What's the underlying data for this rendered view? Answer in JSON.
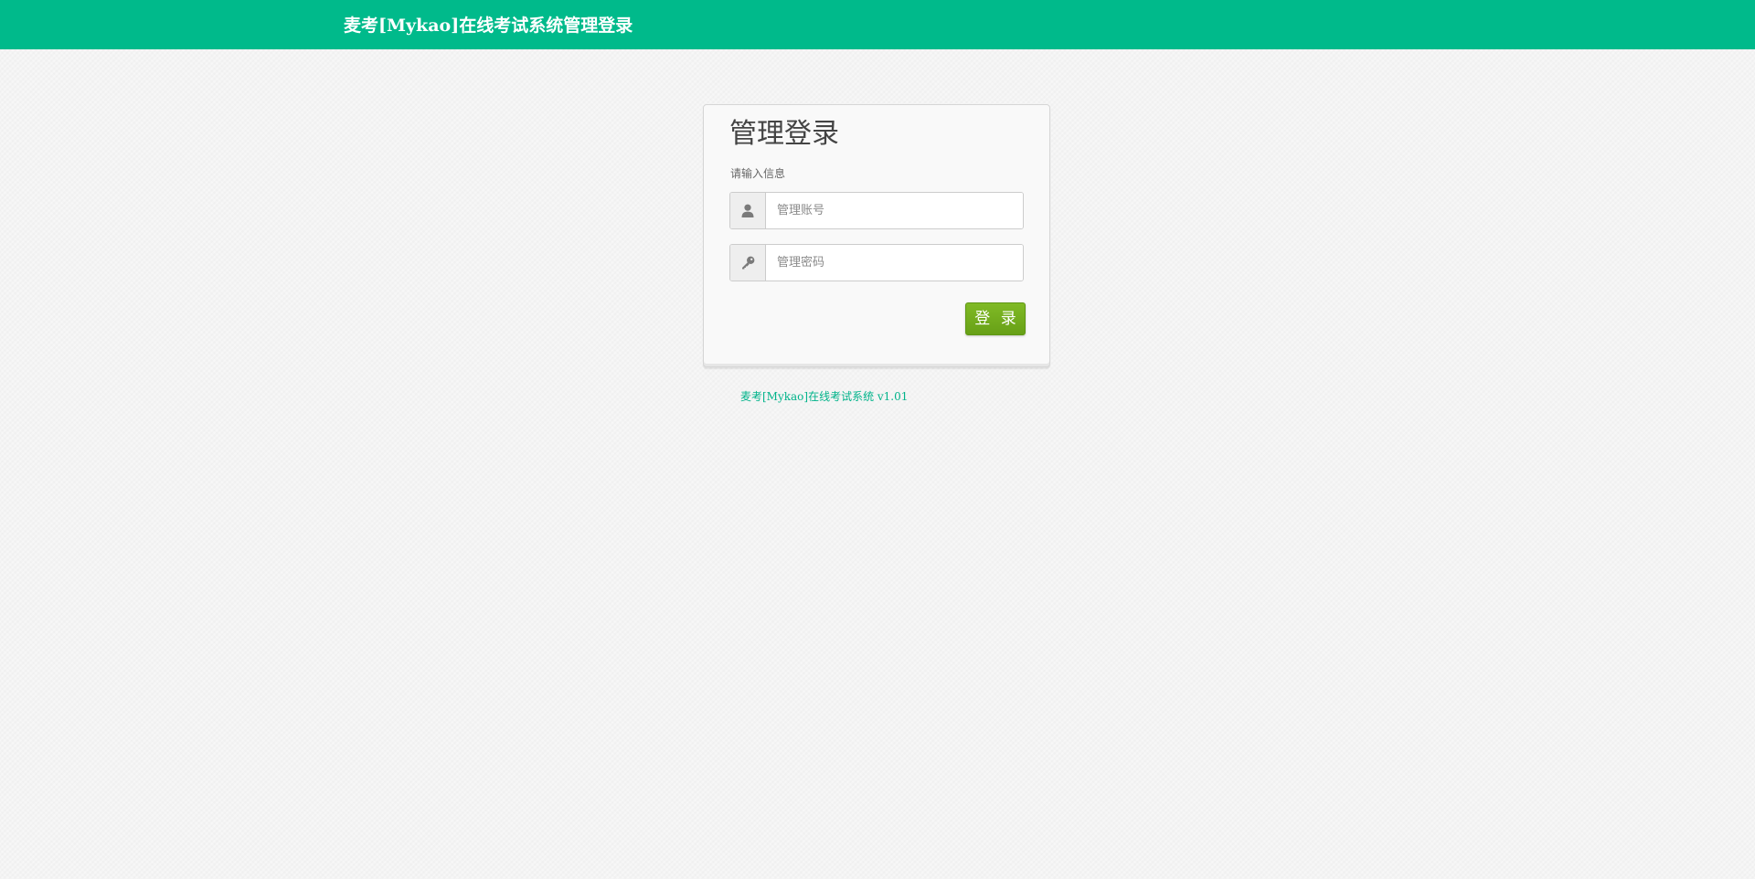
{
  "header": {
    "brand": "麦考[Mykao]在线考试系统管理登录"
  },
  "login": {
    "title": "管理登录",
    "subtitle": "请输入信息",
    "username": {
      "icon": "user-icon",
      "placeholder": "管理账号",
      "value": ""
    },
    "password": {
      "icon": "key-icon",
      "placeholder": "管理密码",
      "value": ""
    },
    "submit_label": "登 录"
  },
  "footer": {
    "link_text": "麦考[Mykao]在线考试系统 v1.01"
  },
  "colors": {
    "header_bg": "#00ba8b",
    "button_bg": "#6ea81c",
    "link": "#00b38a"
  }
}
